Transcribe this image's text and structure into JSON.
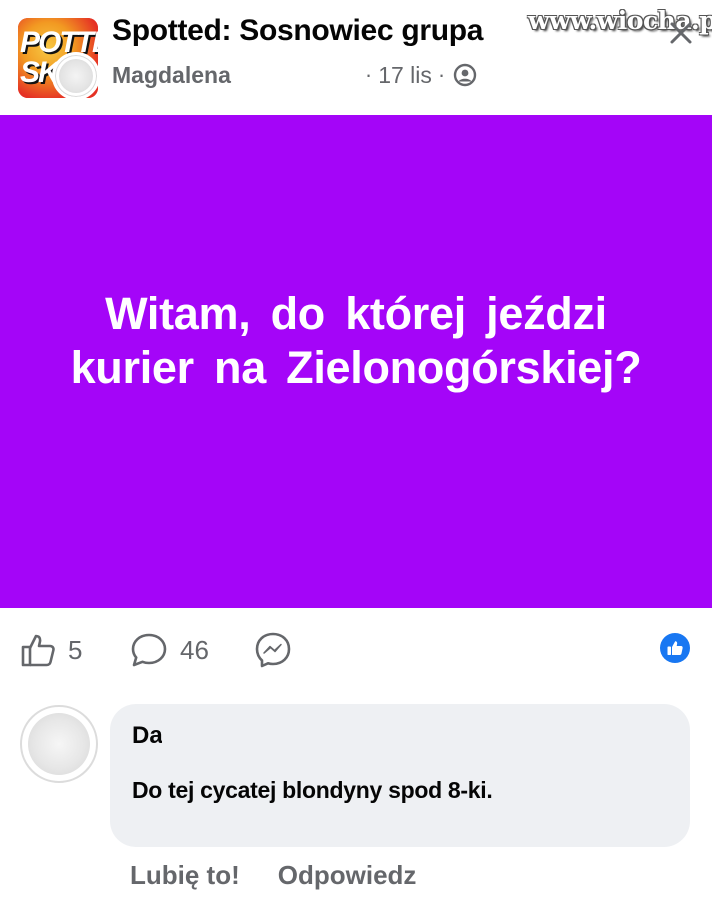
{
  "header": {
    "group_name": "Spotted: Sosnowiec grupa",
    "group_logo_text": "POTTE SK",
    "author_name": "Magdalena",
    "date": "17 lis",
    "separator": "·",
    "watermark": "www.wiocha.pl",
    "privacy_icon": "globe-icon",
    "close_icon": "close-icon"
  },
  "post": {
    "background_color": "#a405f8",
    "text_line1": "Witam, do której jeździ",
    "text_line2": "kurier na Zielonogórskiej?"
  },
  "actions": {
    "like_icon": "thumbs-up-icon",
    "like_count": "5",
    "comment_icon": "comment-icon",
    "comment_count": "46",
    "share_icon": "messenger-icon",
    "reaction_icon": "like-reaction-icon",
    "reaction_color": "#1877f2"
  },
  "comment": {
    "author_name": "Da",
    "text": "Do tej cycatej blondyny spod 8-ki.",
    "like_label": "Lubię to!",
    "reply_label": "Odpowiedz"
  }
}
